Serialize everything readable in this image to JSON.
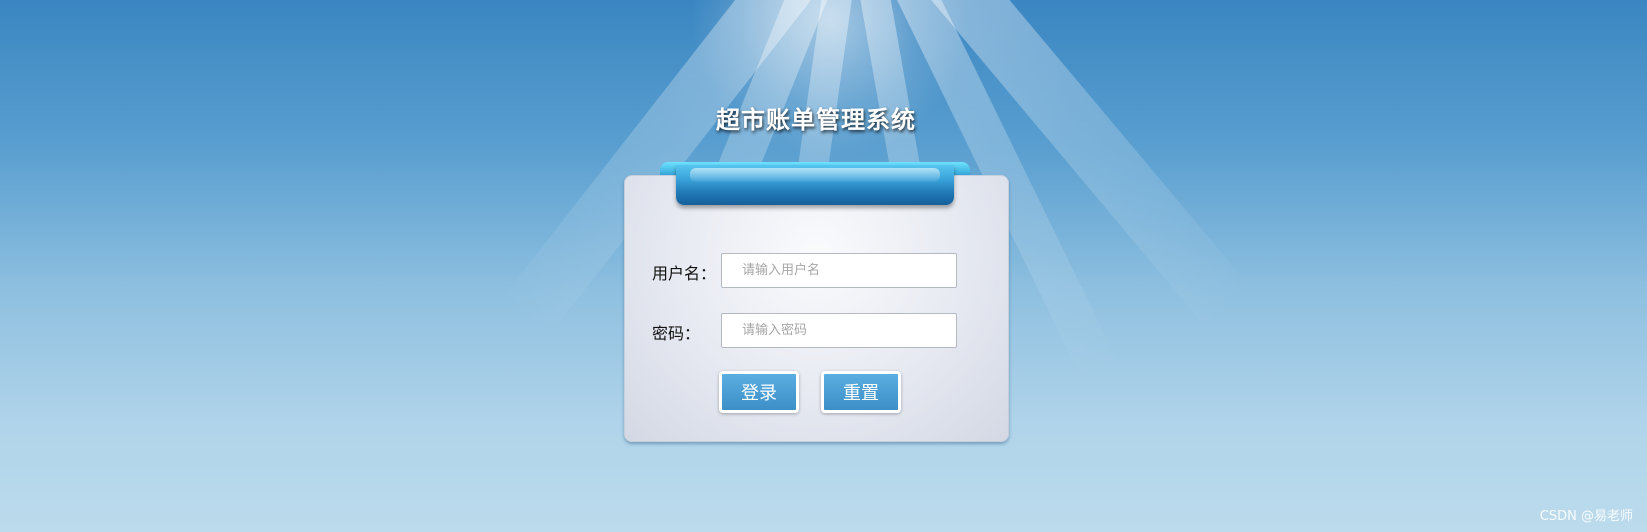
{
  "app": {
    "title": "超市账单管理系统"
  },
  "login_form": {
    "username_label": "用户名：",
    "username_placeholder": "请输入用户名",
    "username_value": "",
    "password_label": "密码：",
    "password_placeholder": "请输入密码",
    "password_value": "",
    "login_button": "登录",
    "reset_button": "重置"
  },
  "watermark": "CSDN @易老师",
  "colors": {
    "button": "#4a9fd5",
    "ribbon": "#2a8ac6",
    "background_top": "#3a86c2",
    "background_bottom": "#bcdbec"
  }
}
